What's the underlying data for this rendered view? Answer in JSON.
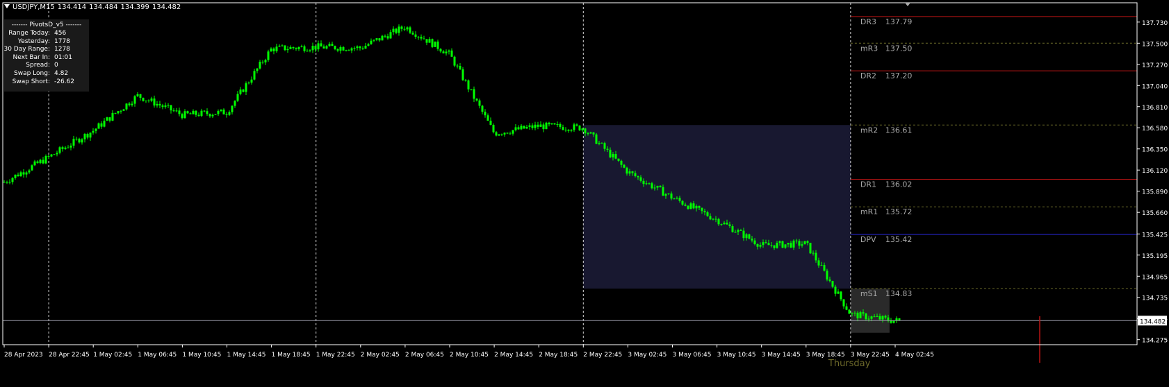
{
  "window": {
    "symbol": "USDJPY,M15",
    "ohlc": [
      "134.414",
      "134.484",
      "134.399",
      "134.482"
    ]
  },
  "info_panel": {
    "title": "------- PivotsD_v5 -------",
    "rows": [
      {
        "label": "Range  Today:",
        "value": "456"
      },
      {
        "label": "Yesterday:",
        "value": "1778"
      },
      {
        "label": "30 Day Range:",
        "value": "1278"
      },
      {
        "label": "Next Bar In:",
        "value": "01:01"
      },
      {
        "label": "Spread:",
        "value": "0"
      },
      {
        "label": "Swap  Long:",
        "value": "4.82"
      },
      {
        "label": "Swap  Short:",
        "value": "-26.62"
      }
    ]
  },
  "colors": {
    "background": "#000000",
    "candle": "#00ff00",
    "border": "#ffffff",
    "grid_dash": "#d8d8d8",
    "resistance": "#b81414",
    "midpoint": "#6e6e2a",
    "pivot": "#2a2ae0",
    "current_price_line": "#9a9aa8",
    "label_text": "#a8a8a8",
    "day_label": "#6e6a2a",
    "highlight_box": "#181830",
    "marker": "#b81414"
  },
  "chart_data": {
    "type": "candlestick",
    "title": "USDJPY,M15",
    "ylim": [
      134.22,
      137.94
    ],
    "y_ticks": [
      "137.730",
      "137.500",
      "137.270",
      "137.040",
      "136.810",
      "136.580",
      "136.350",
      "136.120",
      "135.890",
      "135.660",
      "135.425",
      "135.195",
      "134.965",
      "134.735",
      "134.505",
      "134.275"
    ],
    "x_ticks": [
      "28 Apr 2023",
      "28 Apr 22:45",
      "1 May 02:45",
      "1 May 06:45",
      "1 May 10:45",
      "1 May 14:45",
      "1 May 18:45",
      "1 May 22:45",
      "2 May 02:45",
      "2 May 06:45",
      "2 May 10:45",
      "2 May 14:45",
      "2 May 18:45",
      "2 May 22:45",
      "3 May 02:45",
      "3 May 06:45",
      "3 May 10:45",
      "3 May 14:45",
      "3 May 18:45",
      "3 May 22:45",
      "4 May 02:45"
    ],
    "period_separators": [
      "28 Apr 22:45",
      "1 May 22:45",
      "2 May 22:45",
      "3 May 22:45"
    ],
    "current_price": "134.482",
    "day_label": "Thursday",
    "pivot_levels": [
      {
        "name": "DR3",
        "value": "137.79",
        "kind": "resistance"
      },
      {
        "name": "mR3",
        "value": "137.50",
        "kind": "mid"
      },
      {
        "name": "DR2",
        "value": "137.20",
        "kind": "resistance"
      },
      {
        "name": "mR2",
        "value": "136.61",
        "kind": "mid"
      },
      {
        "name": "DR1",
        "value": "136.02",
        "kind": "resistance"
      },
      {
        "name": "mR1",
        "value": "135.72",
        "kind": "mid"
      },
      {
        "name": "DPV",
        "value": "135.42",
        "kind": "pivot"
      },
      {
        "name": "mS1",
        "value": "134.83",
        "kind": "mid"
      }
    ],
    "prev_day_box": {
      "from": "2 May 22:45",
      "to": "3 May 22:45",
      "high": 136.61,
      "low": 134.83
    },
    "today_box": {
      "from": "3 May 22:45",
      "high": 134.83,
      "low": 134.35
    },
    "close_path": [
      {
        "t": "28 Apr 2023",
        "v": 135.99
      },
      {
        "t": "28 Apr 22:45",
        "v": 136.26
      },
      {
        "t": "1 May 02:45",
        "v": 136.55
      },
      {
        "t": "1 May 06:45",
        "v": 136.93
      },
      {
        "t": "1 May 10:45",
        "v": 136.72
      },
      {
        "t": "1 May 14:45",
        "v": 136.75
      },
      {
        "t": "1 May 18:45",
        "v": 137.44
      },
      {
        "t": "1 May 22:45",
        "v": 137.46
      },
      {
        "t": "2 May 02:45",
        "v": 137.45
      },
      {
        "t": "2 May 06:45",
        "v": 137.68
      },
      {
        "t": "2 May 10:45",
        "v": 137.38
      },
      {
        "t": "2 May 14:45",
        "v": 136.52
      },
      {
        "t": "2 May 18:45",
        "v": 136.6
      },
      {
        "t": "2 May 22:45",
        "v": 136.58
      },
      {
        "t": "3 May 02:45",
        "v": 136.1
      },
      {
        "t": "3 May 06:45",
        "v": 135.82
      },
      {
        "t": "3 May 10:45",
        "v": 135.58
      },
      {
        "t": "3 May 14:45",
        "v": 135.3
      },
      {
        "t": "3 May 18:45",
        "v": 135.32
      },
      {
        "t": "3 May 22:45",
        "v": 134.55
      },
      {
        "t": "4 May 02:45",
        "v": 134.48
      }
    ]
  }
}
